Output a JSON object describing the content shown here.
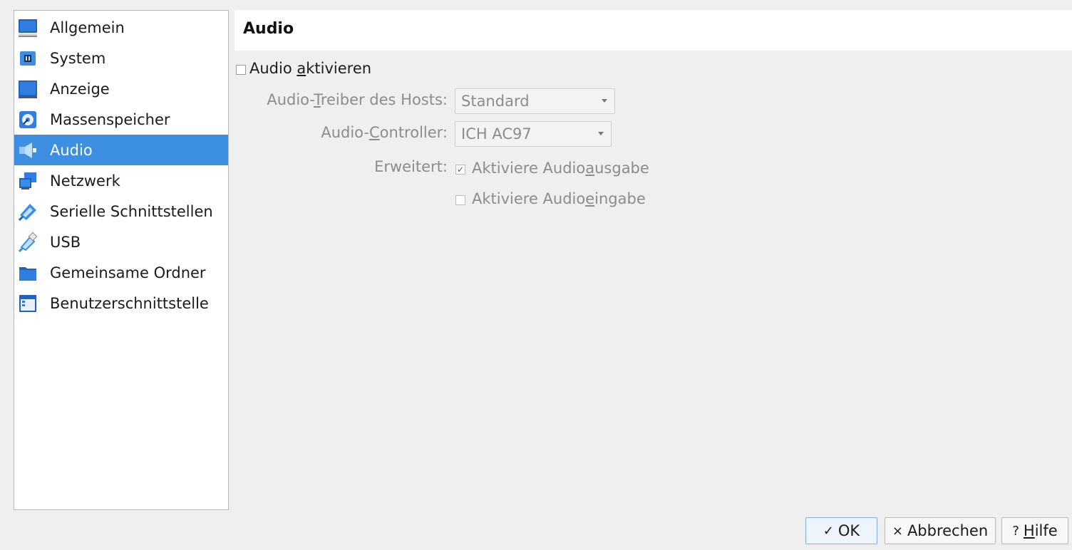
{
  "sidebar": {
    "items": [
      {
        "label": "Allgemein",
        "icon": "monitor-general-icon"
      },
      {
        "label": "System",
        "icon": "chip-icon"
      },
      {
        "label": "Anzeige",
        "icon": "display-icon"
      },
      {
        "label": "Massenspeicher",
        "icon": "storage-disk-icon"
      },
      {
        "label": "Audio",
        "icon": "speaker-icon",
        "selected": true
      },
      {
        "label": "Netzwerk",
        "icon": "network-icon"
      },
      {
        "label": "Serielle Schnittstellen",
        "icon": "serial-port-icon"
      },
      {
        "label": "USB",
        "icon": "usb-icon"
      },
      {
        "label": "Gemeinsame Ordner",
        "icon": "folder-icon"
      },
      {
        "label": "Benutzerschnittstelle",
        "icon": "user-interface-icon"
      }
    ]
  },
  "page": {
    "title": "Audio"
  },
  "audio": {
    "enable": {
      "pre": "Audio ",
      "mnemonic": "a",
      "post": "ktivieren",
      "checked": false
    },
    "host_driver": {
      "label_pre": "Audio-",
      "label_mnemonic": "T",
      "label_post": "reiber des Hosts:",
      "value": "Standard"
    },
    "controller": {
      "label_pre": "Audio-",
      "label_mnemonic": "C",
      "label_post": "ontroller:",
      "value": "ICH AC97"
    },
    "extended_label": "Erweitert:",
    "output": {
      "pre": "Aktiviere Audio",
      "mnemonic": "a",
      "post": "usgabe",
      "checked": true
    },
    "input": {
      "pre": "Aktiviere Audio",
      "mnemonic": "e",
      "post": "ingabe",
      "checked": false
    }
  },
  "buttons": {
    "ok": {
      "icon": "✓",
      "label": "OK"
    },
    "cancel": {
      "icon": "×",
      "label": "Abbrechen"
    },
    "help": {
      "icon": "?",
      "mnemonic": "H",
      "post": "ilfe"
    }
  },
  "colors": {
    "selection": "#3d8fe1",
    "disabled_text": "#8c8c8c"
  }
}
